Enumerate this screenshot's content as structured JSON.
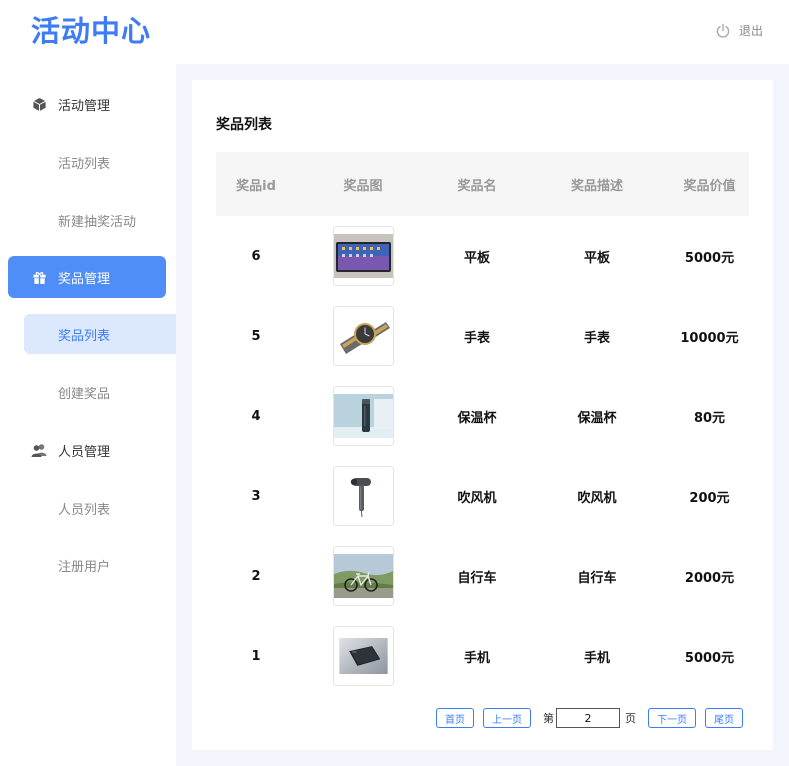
{
  "header": {
    "logo": "活动中心",
    "logout_label": "退出"
  },
  "sidebar": {
    "groups": [
      {
        "label": "活动管理",
        "icon": "cube-icon",
        "items": [
          {
            "label": "活动列表"
          },
          {
            "label": "新建抽奖活动"
          }
        ]
      },
      {
        "label": "奖品管理",
        "icon": "gift-icon",
        "active": true,
        "items": [
          {
            "label": "奖品列表",
            "active": true
          },
          {
            "label": "创建奖品"
          }
        ]
      },
      {
        "label": "人员管理",
        "icon": "users-icon",
        "items": [
          {
            "label": "人员列表"
          },
          {
            "label": "注册用户"
          }
        ]
      }
    ]
  },
  "main": {
    "title": "奖品列表",
    "columns": [
      "奖品id",
      "奖品图",
      "奖品名",
      "奖品描述",
      "奖品价值"
    ],
    "rows": [
      {
        "id": "6",
        "image": "tablet-photo",
        "name": "平板",
        "desc": "平板",
        "value": "5000元"
      },
      {
        "id": "5",
        "image": "watch-photo",
        "name": "手表",
        "desc": "手表",
        "value": "10000元"
      },
      {
        "id": "4",
        "image": "thermos-photo",
        "name": "保温杯",
        "desc": "保温杯",
        "value": "80元"
      },
      {
        "id": "3",
        "image": "hairdryer-photo",
        "name": "吹风机",
        "desc": "吹风机",
        "value": "200元"
      },
      {
        "id": "2",
        "image": "bicycle-photo",
        "name": "自行车",
        "desc": "自行车",
        "value": "2000元"
      },
      {
        "id": "1",
        "image": "phone-photo",
        "name": "手机",
        "desc": "手机",
        "value": "5000元"
      }
    ]
  },
  "pagination": {
    "first": "首页",
    "prev": "上一页",
    "page_prefix": "第",
    "page_value": "2",
    "page_suffix": "页",
    "next": "下一页",
    "last": "尾页"
  },
  "colors": {
    "accent": "#3d7cf4",
    "active_nav_bg": "#4f8ef7",
    "active_sub_bg": "#dce8fd",
    "content_bg": "#f2f5fc"
  }
}
